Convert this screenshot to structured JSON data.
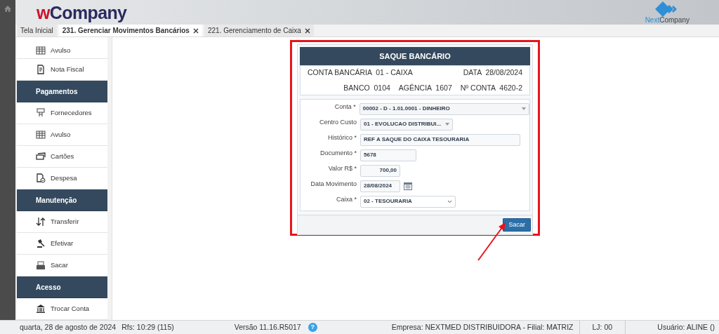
{
  "header": {
    "logo": {
      "prefix": "w",
      "name": "Company"
    },
    "brand": {
      "prefix": "Next",
      "name": "Company"
    }
  },
  "tabs": [
    {
      "label": "Tela Inicial",
      "selected": false,
      "closable": false
    },
    {
      "label": "231. Gerenciar Movimentos Bancários",
      "selected": true,
      "closable": true
    },
    {
      "label": "221. Gerenciamento de Caixa",
      "selected": false,
      "closable": true
    }
  ],
  "sidebar": {
    "items": [
      {
        "kind": "item",
        "label": "Avulso"
      },
      {
        "kind": "item",
        "label": "Nota Fiscal"
      },
      {
        "kind": "header",
        "label": "Pagamentos"
      },
      {
        "kind": "item",
        "label": "Fornecedores"
      },
      {
        "kind": "item",
        "label": "Avulso"
      },
      {
        "kind": "item",
        "label": "Cartões"
      },
      {
        "kind": "item",
        "label": "Despesa"
      },
      {
        "kind": "header",
        "label": "Manutenção"
      },
      {
        "kind": "item",
        "label": "Transferir"
      },
      {
        "kind": "item",
        "label": "Efetivar"
      },
      {
        "kind": "item",
        "label": "Sacar"
      },
      {
        "kind": "header",
        "label": "Acesso"
      },
      {
        "kind": "item",
        "label": "Trocar Conta"
      }
    ]
  },
  "panel": {
    "title": "SAQUE BANCÁRIO",
    "info": [
      {
        "label": "CONTA BANCÁRIA",
        "value": "01 - CAIXA"
      },
      {
        "label": "DATA",
        "value": "28/08/2024"
      },
      {
        "label": "BANCO",
        "value": "0104"
      },
      {
        "label": "AGÊNCIA",
        "value": "1607"
      },
      {
        "label": "Nº CONTA",
        "value": "4620-2"
      }
    ],
    "fields": [
      {
        "kind": "select",
        "label": "Conta *",
        "value": "00002 - D - 1.01.0001 - DINHEIRO"
      },
      {
        "kind": "select",
        "label": "Centro Custo",
        "value": "01 - EVOLUCAO DISTRIBUI..."
      },
      {
        "kind": "text",
        "label": "Histórico *",
        "value": "REF A SAQUE DO CAIXA TESOURARIA"
      },
      {
        "kind": "text",
        "label": "Documento *",
        "value": "5678"
      },
      {
        "kind": "number",
        "label": "Valor R$ *",
        "value": "700,00"
      },
      {
        "kind": "date",
        "label": "Data Movimento",
        "value": "28/08/2024"
      },
      {
        "kind": "dropdown",
        "label": "Caixa *",
        "value": "02 - TESOURARIA"
      }
    ],
    "button": "Sacar"
  },
  "status_bar": {
    "date": "quarta, 28 de agosto de 2024",
    "refresh": "Rfs: 10:29 (115)",
    "version": "Versão 11.16.R5017",
    "help": "?",
    "company": "Empresa: NEXTMED DISTRIBUIDORA - Filial: MATRIZ",
    "store": "LJ: 00",
    "user": "Usuário: ALINE ()"
  }
}
